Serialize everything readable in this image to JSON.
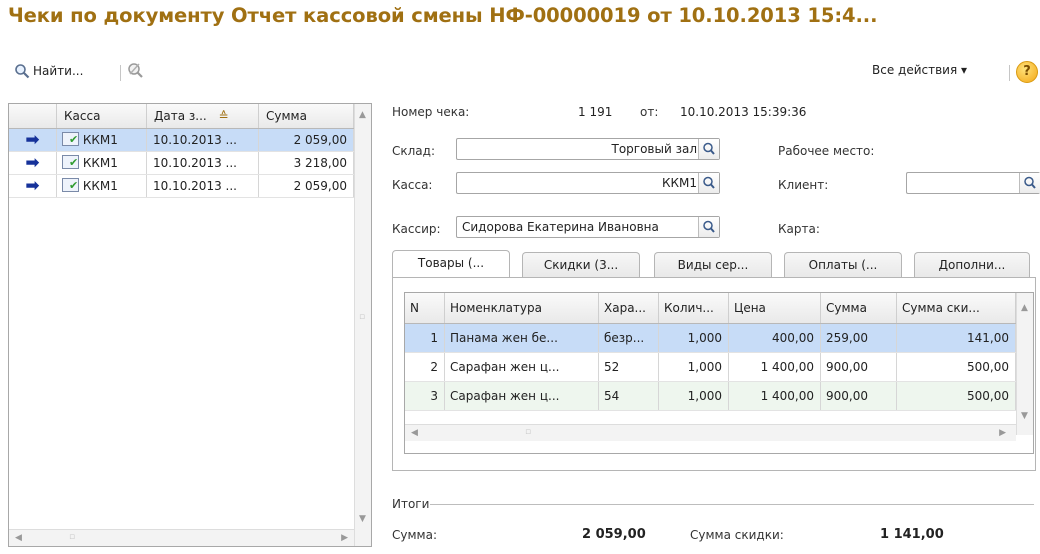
{
  "title": "Чеки по документу Отчет кассовой смены НФ-00000019 от 10.10.2013 15:4...",
  "toolbar": {
    "find_label": "Найти...",
    "all_actions_label": "Все действия ▾",
    "help_label": "?"
  },
  "left_table": {
    "columns": [
      "Касса",
      "Дата з...",
      "Сумма"
    ],
    "rows": [
      {
        "kassa": "ККМ1",
        "date": "10.10.2013 ...",
        "sum": "2 059,00"
      },
      {
        "kassa": "ККМ1",
        "date": "10.10.2013 ...",
        "sum": "3 218,00"
      },
      {
        "kassa": "ККМ1",
        "date": "10.10.2013 ...",
        "sum": "2 059,00"
      }
    ]
  },
  "form": {
    "check_number_label": "Номер чека:",
    "check_number": "1 191",
    "from_label": "от:",
    "check_date": "10.10.2013 15:39:36",
    "warehouse_label": "Склад:",
    "warehouse": "Торговый зал",
    "register_label": "Касса:",
    "register": "ККМ1",
    "cashier_label": "Кассир:",
    "cashier": "Сидорова Екатерина Ивановна",
    "workplace_label": "Рабочее место:",
    "client_label": "Клиент:",
    "client": "",
    "card_label": "Карта:"
  },
  "tabs": [
    "Товары (...",
    "Скидки (3...",
    "Виды сер...",
    "Оплаты (...",
    "Дополни..."
  ],
  "items_table": {
    "columns": [
      "N",
      "Номенклатура",
      "Хара...",
      "Колич...",
      "Цена",
      "Сумма",
      "Сумма ски..."
    ],
    "rows": [
      {
        "n": "1",
        "name": "Панама жен бе...",
        "char": "безр...",
        "qty": "1,000",
        "price": "400,00",
        "sum": "259,00",
        "discount": "141,00"
      },
      {
        "n": "2",
        "name": "Сарафан жен ц...",
        "char": "52",
        "qty": "1,000",
        "price": "1 400,00",
        "sum": "900,00",
        "discount": "500,00"
      },
      {
        "n": "3",
        "name": "Сарафан жен ц...",
        "char": "54",
        "qty": "1,000",
        "price": "1 400,00",
        "sum": "900,00",
        "discount": "500,00"
      }
    ]
  },
  "totals": {
    "header": "Итоги",
    "sum_label": "Сумма:",
    "sum": "2 059,00",
    "discount_label": "Сумма скидки:",
    "discount": "1 141,00"
  }
}
